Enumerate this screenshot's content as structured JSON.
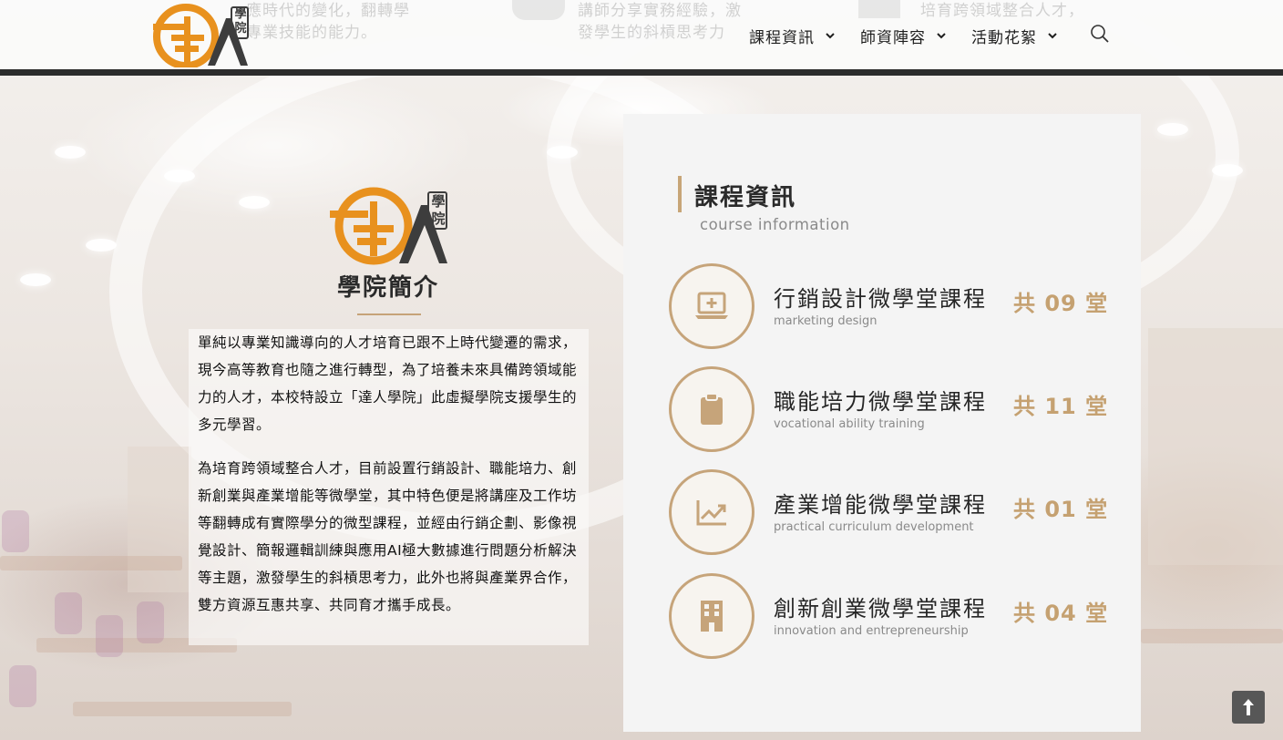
{
  "header": {
    "ghost_text": {
      "col1_line1": "應時代的變化，翻轉學",
      "col1_line2": "專業技能的能力。",
      "col2_line1": "講師分享實務經驗，激",
      "col2_line2": "發學生的斜槓思考力",
      "col3_line1": "培育跨領域整合人才，"
    },
    "logo": {
      "mark": "達人",
      "tag": "學院"
    },
    "nav": [
      {
        "label": "課程資訊"
      },
      {
        "label": "師資陣容"
      },
      {
        "label": "活動花絮"
      }
    ]
  },
  "intro": {
    "logo": {
      "mark": "達人",
      "tag": "學院"
    },
    "title": "學院簡介",
    "paragraph_1": "單純以專業知識導向的人才培育已跟不上時代變遷的需求，現今高等教育也隨之進行轉型，為了培養未來具備跨領域能力的人才，本校特設立「達人學院」此虛擬學院支援學生的多元學習。",
    "paragraph_2": "為培育跨領域整合人才，目前設置行銷設計、職能培力、創新創業與產業增能等微學堂，其中特色便是將講座及工作坊等翻轉成有實際學分的微型課程，並經由行銷企劃、影像視覺設計、簡報邏輯訓練與應用AI極大數據進行問題分析解決等主題，激發學生的斜槓思考力，此外也將與產業界合作，雙方資源互惠共享、共同育才攜手成長。"
  },
  "courses_panel": {
    "title": "課程資訊",
    "subtitle": "course information",
    "courses": [
      {
        "name": "行銷設計微學堂課程",
        "en": "marketing design",
        "count": "共 09 堂",
        "icon": "laptop-plus-icon"
      },
      {
        "name": "職能培力微學堂課程",
        "en": "vocational ability training",
        "count": "共 11 堂",
        "icon": "clipboard-icon"
      },
      {
        "name": "產業增能微學堂課程",
        "en": "practical curriculum development",
        "count": "共 01 堂",
        "icon": "trend-chart-icon"
      },
      {
        "name": "創新創業微學堂課程",
        "en": "innovation and entrepreneurship",
        "count": "共 04 堂",
        "icon": "building-icon"
      }
    ]
  },
  "colors": {
    "accent": "#c6a47a",
    "count": "#c5a171",
    "header_bar": "#2c2c2c",
    "logo_orange": "#e8911e",
    "logo_dark": "#3d3d3d"
  }
}
